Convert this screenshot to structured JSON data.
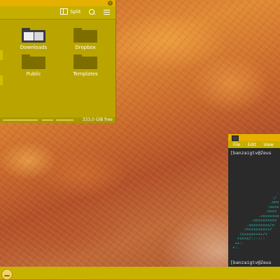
{
  "file_manager": {
    "toolbar": {
      "split_label": "Split",
      "icons": [
        "split-icon",
        "search-icon",
        "menu-icon"
      ]
    },
    "items": [
      {
        "label": "Downloads",
        "icon": "downloads-folder-icon"
      },
      {
        "label": "Dropbox",
        "icon": "folder-icon"
      },
      {
        "label": "Public",
        "icon": "folder-icon"
      },
      {
        "label": "Templates",
        "icon": "folder-icon"
      }
    ],
    "status": {
      "free": "333,0 GiB free"
    }
  },
  "terminal": {
    "menu": [
      "File",
      "Edit",
      "View"
    ],
    "prompt": "[banzaigtv@Zeus",
    "ascii_lines": [
      "                    .",
      "                  :/",
      "                 .oos",
      "                :osss",
      "               .osss",
      "            .+sssssso",
      "         .osssssssss",
      "       .ossssssss/o",
      "      /ossssssss+/",
      "    /sssso++++/+",
      "   +ssss/::-:::",
      "  ++:-",
      " +:."
    ]
  },
  "panel": {
    "menu_icon": "app-menu-icon"
  },
  "colors": {
    "accent": "#e6b000",
    "window_bg": "#b8a300",
    "terminal_bg": "#2a2a2a",
    "ascii": "#21b8a6"
  }
}
